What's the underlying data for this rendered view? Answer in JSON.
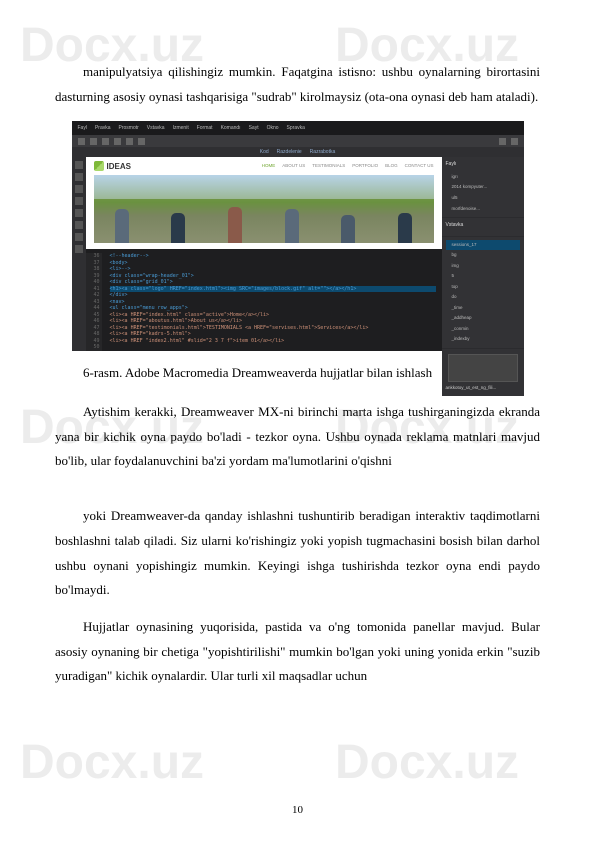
{
  "watermark": "Docx.uz",
  "paragraphs": {
    "p1": "manipulyatsiya qilishingiz mumkin. Faqatgina istisno: ushbu oynalarning birortasini dasturning asosiy oynasi tashqarisiga \"sudrab\" kirolmaysiz (ota-ona oynasi deb ham ataladi).",
    "p2": "Aytishim kerakki, Dreamweaver MX-ni birinchi marta ishga tushirganingizda ekranda yana bir kichik oyna paydo bo'ladi - tezkor oyna. Ushbu oynada reklama matnlari mavjud bo'lib, ular foydalanuvchini ba'zi yordam ma'lumotlarini o'qishni",
    "p3": "yoki Dreamweaver-da qanday ishlashni tushuntirib beradigan interaktiv taqdimotlarni boshlashni talab qiladi. Siz ularni ko'rishingiz yoki yopish tugmachasini bosish bilan darhol ushbu oynani yopishingiz mumkin. Keyingi ishga tushirishda tezkor oyna endi paydo bo'lmaydi.",
    "p4": "Hujjatlar oynasining yuqorisida, pastida va o'ng tomonida panellar mavjud. Bular asosiy oynaning bir chetiga \"yopishtirilishi\" mumkin bo'lgan yoki uning yonida erkin \"suzib yuradigan\" kichik oynalardir. Ular turli xil maqsadlar uchun"
  },
  "caption": "6-rasm. Adobe Macromedia Dreamweaverda hujjatlar bilan ishlash",
  "screenshot": {
    "menubar": [
      "Fayl",
      "Pravka",
      "Prosmotr",
      "Vstavka",
      "Izmenit",
      "Format",
      "Komandı",
      "Sayt",
      "Okno",
      "Spravka"
    ],
    "tabs": [
      "Kod",
      "Razdelenie",
      "Razrabotka"
    ],
    "logo": "IDEAS",
    "nav": [
      "HOME",
      "ABOUT US",
      "TESTIMONIALS",
      "PORTFOLIO",
      "BLOG",
      "CONTACT US"
    ],
    "code_lines": [
      "<!--header-->",
      "<body>",
      "  <li>-->",
      "  <div class=\"wrap-header_01\">",
      "    <div class=\"grid_01\">",
      "      <h1><a class=\"logo\" HREF=\"index.html\"><img SRC=\"images/block.gif\" alt=\"\"></a></h1>",
      "    </div>",
      "    <nav>",
      "      <ul class=\"menu row_apps\">",
      "        <li><a HREF=\"index.html\" class=\"active\">Home</a></li>",
      "        <li><a HREF=\"aboutus.html\">About us</a></li>",
      "        <li><a HREF=\"testimonials.html\">TESTIMONIALS <a HREF=\"servises.html\">Services</a></li>",
      "        <li><a HREF=\"kadrs-5.html\">",
      "",
      "            <li><a HREF \"index2.html\" #slid=\"2 3 7 f\">item 01</a></li>"
    ],
    "gutter": [
      "36",
      "37",
      "38",
      "39",
      "40",
      "41",
      "42",
      "43",
      "44",
      "45",
      "46",
      "47",
      "48",
      "49",
      "50"
    ],
    "right_panel": {
      "title1": "Faylı",
      "files": [
        "igrı",
        "2014 kompyuter...",
        "ul5",
        "morfdenoise..."
      ],
      "title2": "Vstavka",
      "tree": [
        "sessions_17",
        "bg",
        "img",
        "5",
        "top",
        "do",
        "_time",
        "_addheap",
        "_conmin",
        "_indexby"
      ],
      "thumb_label": "ankkotoy_ut_est_ng_fili..."
    }
  },
  "page_number": "10"
}
